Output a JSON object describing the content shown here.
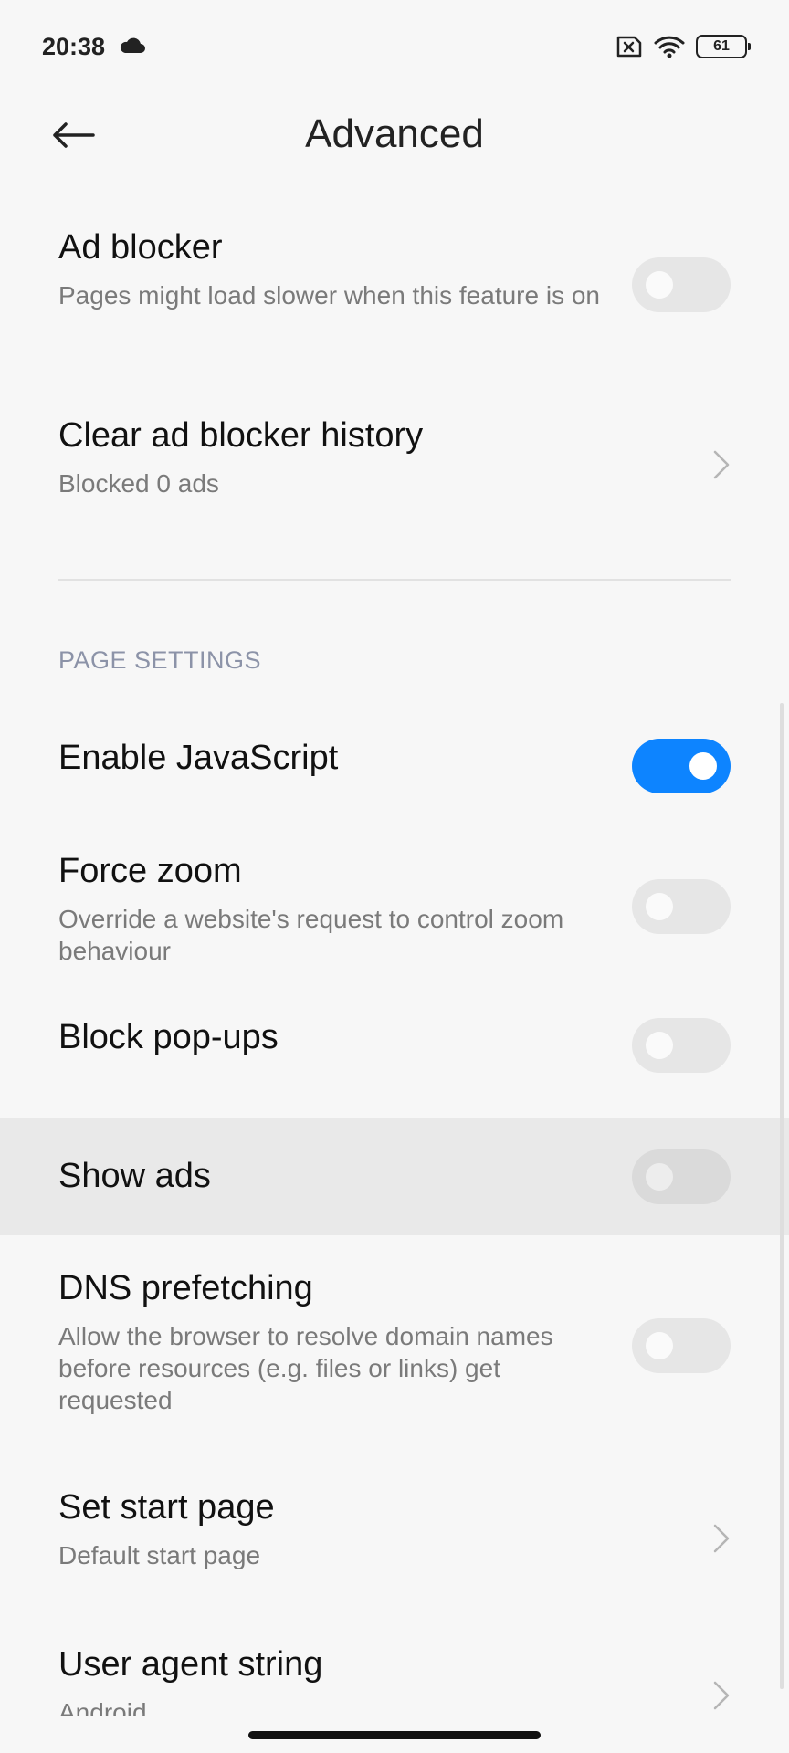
{
  "status_bar": {
    "time": "20:38",
    "weather_icon": "cloud-icon",
    "battery_level": "61"
  },
  "header": {
    "title": "Advanced",
    "back_icon": "arrow-left-icon"
  },
  "settings": {
    "ad_blocker": {
      "title": "Ad blocker",
      "subtitle": "Pages might load slower when this feature is on",
      "enabled": false
    },
    "clear_history": {
      "title": "Clear ad blocker history",
      "subtitle": "Blocked 0 ads"
    },
    "page_settings_label": "PAGE SETTINGS",
    "javascript": {
      "title": "Enable JavaScript",
      "enabled": true
    },
    "force_zoom": {
      "title": "Force zoom",
      "subtitle": "Override a website's request to control zoom behaviour",
      "enabled": false
    },
    "block_popups": {
      "title": "Block pop-ups",
      "enabled": false
    },
    "show_ads": {
      "title": "Show ads",
      "enabled": false
    },
    "dns_prefetching": {
      "title": "DNS prefetching",
      "subtitle": "Allow the browser to resolve domain names before resources (e.g. files or links) get requested",
      "enabled": false
    },
    "start_page": {
      "title": "Set start page",
      "subtitle": "Default start page"
    },
    "user_agent": {
      "title": "User agent string",
      "subtitle": "Android"
    }
  },
  "colors": {
    "toggle_on": "#0d84ff",
    "toggle_off": "#e6e6e6",
    "section_label": "#8c93a8"
  }
}
